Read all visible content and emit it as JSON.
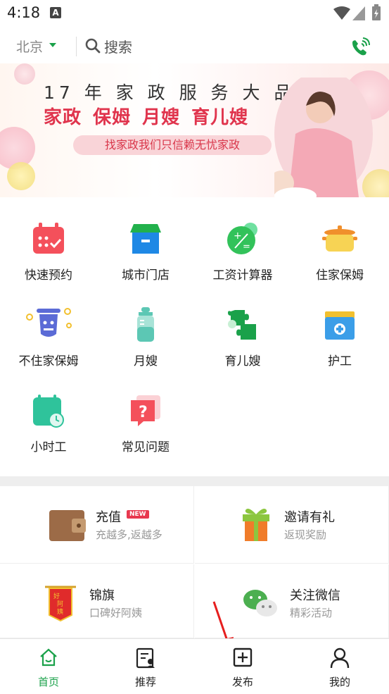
{
  "status_bar": {
    "time": "4:18",
    "notif_icon": "A"
  },
  "header": {
    "city": "北京",
    "search_placeholder": "搜索",
    "phone_icon": "phone-icon"
  },
  "banner": {
    "title": "17 年 家 政 服 务 大 品 牌",
    "services": "家政  保姆  月嫂  育儿嫂",
    "slogan": "找家政我们只信赖无忧家政"
  },
  "services": [
    {
      "label": "快速预约",
      "icon": "calendar-icon",
      "color": "#f4505b"
    },
    {
      "label": "城市门店",
      "icon": "store-icon",
      "color": "#1e88e5"
    },
    {
      "label": "工资计算器",
      "icon": "calculator-icon",
      "color": "#32c25a"
    },
    {
      "label": "住家保姆",
      "icon": "pot-icon",
      "color": "#f5c842"
    },
    {
      "label": "不住家保姆",
      "icon": "scooter-icon",
      "color": "#5b6bd6"
    },
    {
      "label": "月嫂",
      "icon": "bottle-icon",
      "color": "#5cc7b4"
    },
    {
      "label": "育儿嫂",
      "icon": "puzzle-icon",
      "color": "#1aa14a"
    },
    {
      "label": "护工",
      "icon": "medkit-icon",
      "color": "#3b9ee8"
    },
    {
      "label": "小时工",
      "icon": "clock-calendar-icon",
      "color": "#2fc39b"
    },
    {
      "label": "常见问题",
      "icon": "question-icon",
      "color": "#f4505b"
    }
  ],
  "cards": [
    {
      "title": "充值",
      "subtitle": "充越多,返越多",
      "badge": "NEW",
      "icon": "wallet-icon"
    },
    {
      "title": "邀请有礼",
      "subtitle": "返现奖励",
      "icon": "gift-icon"
    },
    {
      "title": "锦旗",
      "subtitle": "口碑好阿姨",
      "icon": "banner-flag-icon",
      "flag_text": "好阿姨"
    },
    {
      "title": "关注微信",
      "subtitle": "精彩活动",
      "icon": "wechat-icon"
    }
  ],
  "nav": [
    {
      "label": "首页",
      "icon": "home-icon",
      "active": true
    },
    {
      "label": "推荐",
      "icon": "recommend-icon",
      "active": false
    },
    {
      "label": "发布",
      "icon": "publish-icon",
      "active": false
    },
    {
      "label": "我的",
      "icon": "profile-icon",
      "active": false
    }
  ],
  "colors": {
    "accent": "#1aa14a",
    "brand_red": "#e0344d"
  }
}
